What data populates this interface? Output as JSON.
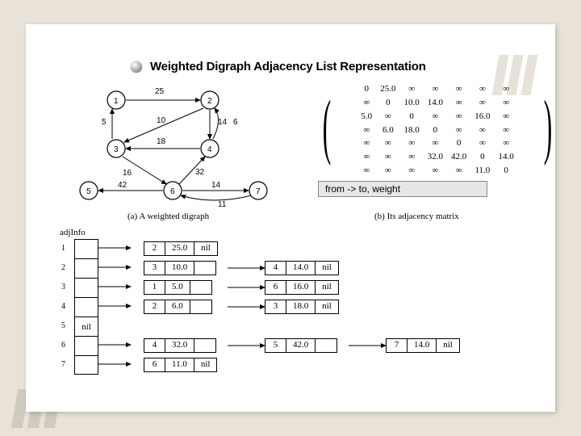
{
  "title": "Weighted Digraph Adjacency  List Representation",
  "caption_a": "(a) A weighted digraph",
  "caption_b": "(b) Its adjacency matrix",
  "label_bar": "from -> to, weight",
  "adjinfo_label": "adjInfo",
  "graph": {
    "nodes": [
      "1",
      "2",
      "3",
      "4",
      "5",
      "6",
      "7"
    ],
    "edges": [
      {
        "from": 1,
        "to": 2,
        "w": "25"
      },
      {
        "from": 2,
        "to": 3,
        "w": "10"
      },
      {
        "from": 2,
        "to": 4,
        "w": "14"
      },
      {
        "from": 3,
        "to": 1,
        "w": "5"
      },
      {
        "from": 3,
        "to": 6,
        "w": "16"
      },
      {
        "from": 4,
        "to": 2,
        "w": "6"
      },
      {
        "from": 4,
        "to": 3,
        "w": "18"
      },
      {
        "from": 6,
        "to": 4,
        "w": "32"
      },
      {
        "from": 6,
        "to": 5,
        "w": "42"
      },
      {
        "from": 6,
        "to": 7,
        "w": "14"
      },
      {
        "from": 7,
        "to": 6,
        "w": "11"
      }
    ]
  },
  "matrix": [
    [
      "0",
      "25.0",
      "∞",
      "∞",
      "∞",
      "∞",
      "∞"
    ],
    [
      "∞",
      "0",
      "10.0",
      "14.0",
      "∞",
      "∞",
      "∞"
    ],
    [
      "5.0",
      "∞",
      "0",
      "∞",
      "∞",
      "16.0",
      "∞"
    ],
    [
      "∞",
      "6.0",
      "18.0",
      "0",
      "∞",
      "∞",
      "∞"
    ],
    [
      "∞",
      "∞",
      "∞",
      "∞",
      "0",
      "∞",
      "∞"
    ],
    [
      "∞",
      "∞",
      "∞",
      "32.0",
      "42.0",
      "0",
      "14.0"
    ],
    [
      "∞",
      "∞",
      "∞",
      "∞",
      "∞",
      "11.0",
      "0"
    ]
  ],
  "adjlist": [
    {
      "idx": "1",
      "head": "",
      "nodes": [
        {
          "to": "2",
          "w": "25.0",
          "next": "nil"
        }
      ]
    },
    {
      "idx": "2",
      "head": "",
      "nodes": [
        {
          "to": "3",
          "w": "10.0",
          "next": ""
        },
        {
          "to": "4",
          "w": "14.0",
          "next": "nil"
        }
      ]
    },
    {
      "idx": "3",
      "head": "",
      "nodes": [
        {
          "to": "1",
          "w": "5.0",
          "next": ""
        },
        {
          "to": "6",
          "w": "16.0",
          "next": "nil"
        }
      ]
    },
    {
      "idx": "4",
      "head": "",
      "nodes": [
        {
          "to": "2",
          "w": "6.0",
          "next": ""
        },
        {
          "to": "3",
          "w": "18.0",
          "next": "nil"
        }
      ]
    },
    {
      "idx": "5",
      "head": "nil",
      "nodes": []
    },
    {
      "idx": "6",
      "head": "",
      "nodes": [
        {
          "to": "4",
          "w": "32.0",
          "next": ""
        },
        {
          "to": "5",
          "w": "42.0",
          "next": ""
        },
        {
          "to": "7",
          "w": "14.0",
          "next": "nil"
        }
      ]
    },
    {
      "idx": "7",
      "head": "",
      "nodes": [
        {
          "to": "6",
          "w": "11.0",
          "next": "nil"
        }
      ]
    }
  ]
}
